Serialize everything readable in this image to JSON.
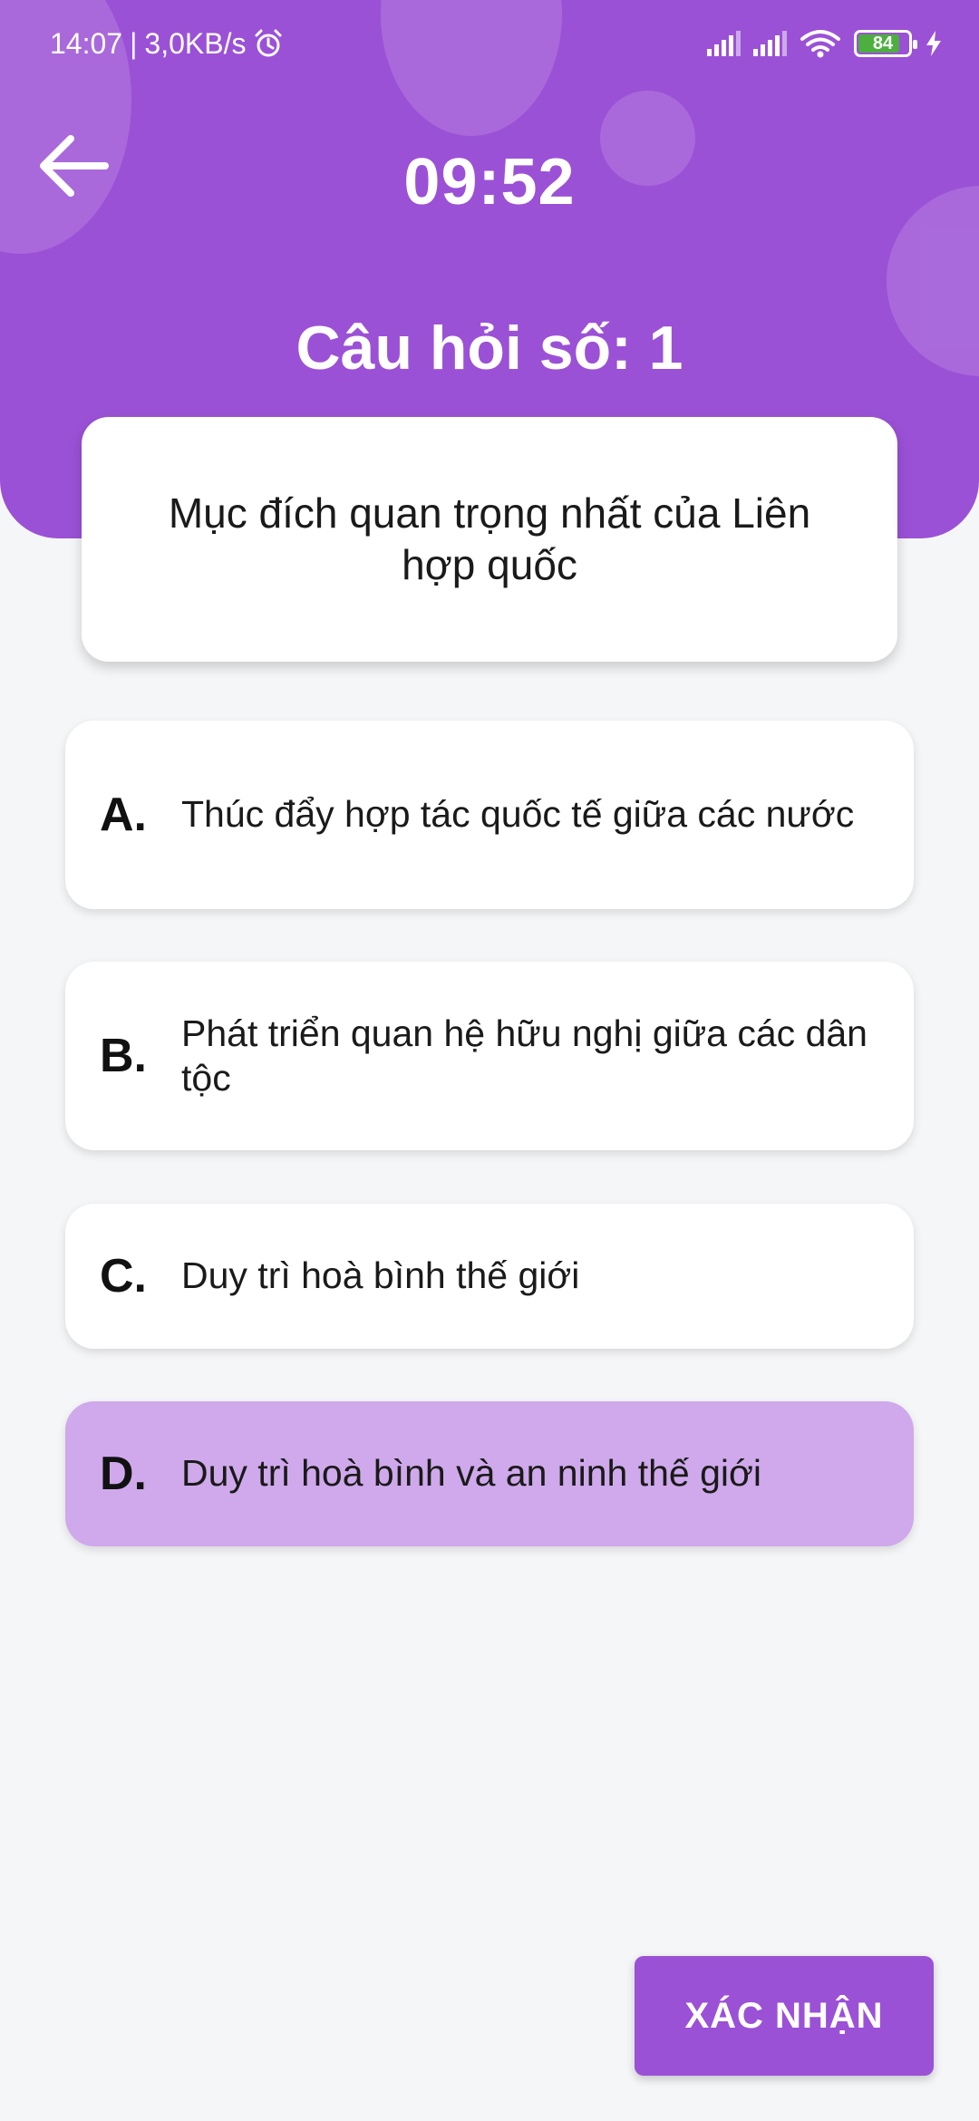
{
  "status_bar": {
    "time": "14:07",
    "separator": "|",
    "speed": "3,0KB/s",
    "battery_level": "84",
    "battery_percent": 84
  },
  "header": {
    "timer": "09:52",
    "question_number": "Câu hỏi số: 1"
  },
  "question": {
    "text": "Mục đích quan trọng nhất của Liên hợp quốc"
  },
  "options": [
    {
      "letter": "A.",
      "text": "Thúc đẩy hợp tác quốc tế giữa các nước",
      "selected": false
    },
    {
      "letter": "B.",
      "text": "Phát triển quan hệ hữu nghị giữa các dân tộc",
      "selected": false
    },
    {
      "letter": "C.",
      "text": "Duy trì hoà bình thế giới",
      "selected": false
    },
    {
      "letter": "D.",
      "text": "Duy trì hoà bình và an ninh thế giới",
      "selected": true
    }
  ],
  "confirm_button": {
    "label": "XÁC NHẬN"
  },
  "colors": {
    "primary": "#9b51d6",
    "selected_option": "#cfa9eb",
    "background": "#f5f6f8",
    "battery_fill": "#4caf3f"
  },
  "icons": {
    "back": "arrow-left-icon",
    "alarm": "alarm-clock-icon",
    "signal": "cell-signal-icon",
    "wifi": "wifi-icon",
    "battery": "battery-icon",
    "charging": "charging-bolt-icon"
  }
}
